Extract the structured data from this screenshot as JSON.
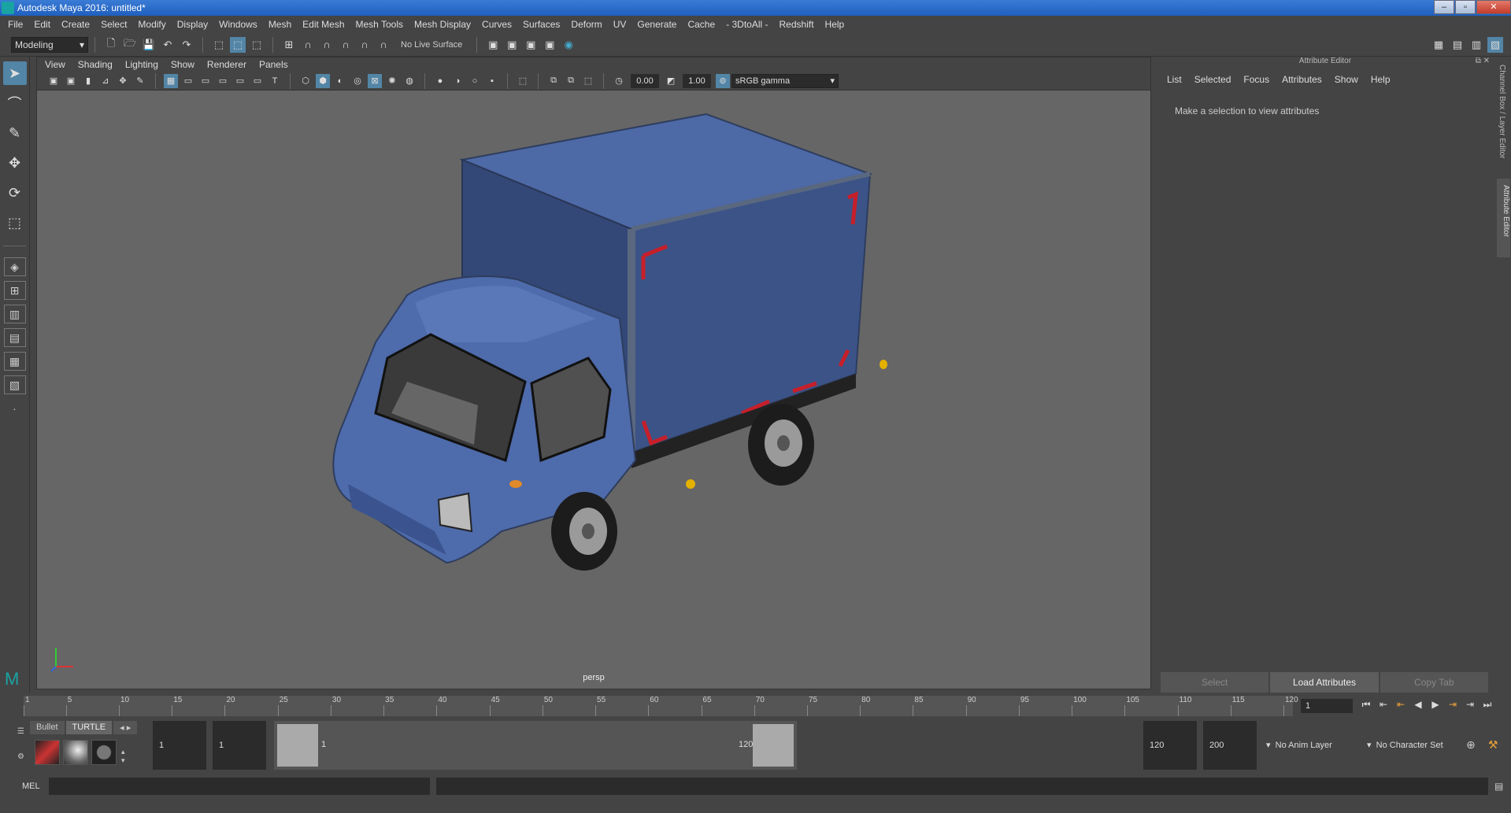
{
  "window": {
    "title": "Autodesk Maya 2016: untitled*"
  },
  "menu": [
    "File",
    "Edit",
    "Create",
    "Select",
    "Modify",
    "Display",
    "Windows",
    "Mesh",
    "Edit Mesh",
    "Mesh Tools",
    "Mesh Display",
    "Curves",
    "Surfaces",
    "Deform",
    "UV",
    "Generate",
    "Cache",
    "- 3DtoAll -",
    "Redshift",
    "Help"
  ],
  "shelf": {
    "mode": "Modeling",
    "live_surface": "No Live Surface"
  },
  "viewport": {
    "menu": [
      "View",
      "Shading",
      "Lighting",
      "Show",
      "Renderer",
      "Panels"
    ],
    "exposure": "0.00",
    "gamma": "1.00",
    "color_space": "sRGB gamma",
    "camera": "persp"
  },
  "attribute_editor": {
    "title": "Attribute Editor",
    "menu": [
      "List",
      "Selected",
      "Focus",
      "Attributes",
      "Show",
      "Help"
    ],
    "message": "Make a selection to view attributes",
    "buttons": {
      "select": "Select",
      "load": "Load Attributes",
      "copy": "Copy Tab"
    }
  },
  "side_tabs": {
    "channel_box": "Channel Box / Layer Editor",
    "attribute_editor": "Attribute Editor"
  },
  "timeline": {
    "ticks": [
      "1",
      "5",
      "10",
      "15",
      "20",
      "25",
      "30",
      "35",
      "40",
      "45",
      "50",
      "55",
      "60",
      "65",
      "70",
      "75",
      "80",
      "85",
      "90",
      "95",
      "100",
      "105",
      "110",
      "115",
      "120"
    ],
    "current_frame": "1"
  },
  "range": {
    "tabs": [
      "Bullet",
      "TURTLE"
    ],
    "start": "1",
    "playback_start": "1",
    "slider_start": "1",
    "slider_end": "120",
    "playback_end": "120",
    "end": "200",
    "anim_layer": "No Anim Layer",
    "char_set": "No Character Set"
  },
  "command": {
    "label": "MEL"
  },
  "colors": {
    "truck_body": "#3f5a93",
    "accent_selection": "#5285a6",
    "viewport_bg": "#666666"
  }
}
